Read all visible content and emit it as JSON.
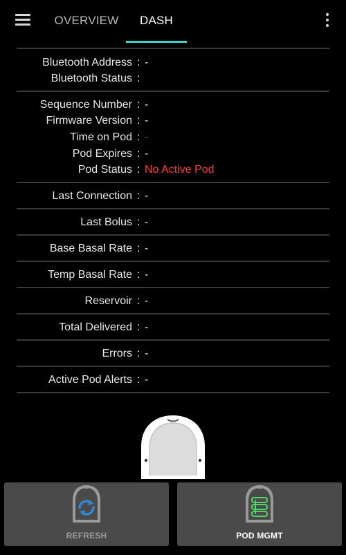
{
  "tabs": [
    {
      "label": "OVERVIEW",
      "active": false
    },
    {
      "label": "DASH",
      "active": true
    }
  ],
  "colors": {
    "accent": "#3fd1c2",
    "error": "#ff3b30",
    "muted_value": "#a43cc8",
    "button_bg": "#4a4a4a"
  },
  "rows": {
    "bluetooth_address": {
      "label": "Bluetooth Address",
      "value": "-"
    },
    "bluetooth_status": {
      "label": "Bluetooth Status",
      "value": ""
    },
    "sequence_number": {
      "label": "Sequence Number",
      "value": "-"
    },
    "firmware_version": {
      "label": "Firmware Version",
      "value": "-"
    },
    "time_on_pod": {
      "label": "Time on Pod",
      "value": "-"
    },
    "pod_expires": {
      "label": "Pod Expires",
      "value": "-"
    },
    "pod_status": {
      "label": "Pod Status",
      "value": "No Active Pod"
    },
    "last_connection": {
      "label": "Last Connection",
      "value": "-"
    },
    "last_bolus": {
      "label": "Last Bolus",
      "value": "-"
    },
    "base_basal_rate": {
      "label": "Base Basal Rate",
      "value": "-"
    },
    "temp_basal_rate": {
      "label": "Temp Basal Rate",
      "value": "-"
    },
    "reservoir": {
      "label": "Reservoir",
      "value": "-"
    },
    "total_delivered": {
      "label": "Total Delivered",
      "value": "-"
    },
    "errors": {
      "label": "Errors",
      "value": "-"
    },
    "active_pod_alerts": {
      "label": "Active Pod Alerts",
      "value": "-"
    }
  },
  "separator": ":",
  "icons": {
    "menu": "hamburger-menu-icon",
    "overflow": "more-vert-icon",
    "pod": "pod-icon",
    "refresh": "refresh-icon",
    "pod_management": "pod-management-icon"
  },
  "buttons": {
    "refresh": {
      "label": "REFRESH",
      "enabled": false
    },
    "pod_mgmt": {
      "label": "POD MGMT",
      "enabled": true
    }
  }
}
